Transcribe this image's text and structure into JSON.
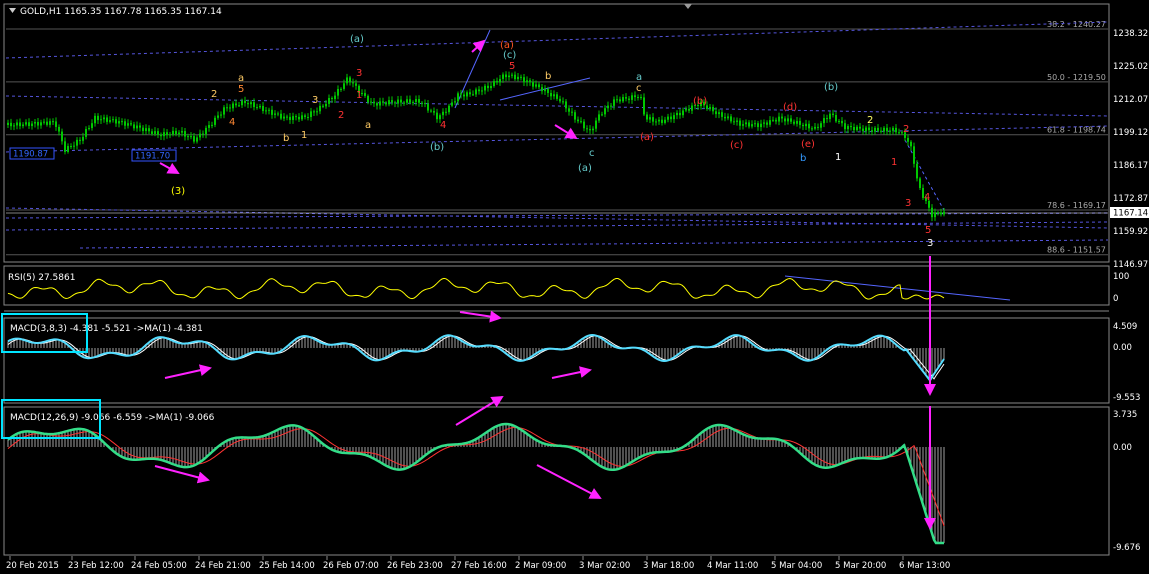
{
  "symbol_title": "GOLD,H1  1165.35 1167.78 1165.35 1167.14",
  "rsi_title": "RSI(5) 27.5861",
  "macd_fast_title": "MACD(3,8,3) -4.381 -5.521  ->MA(1) -4.381",
  "macd_slow_title": "MACD(12,26,9) -9.066 -6.559  ->MA(1) -9.066",
  "price_axis": [
    "1238.32",
    "1225.02",
    "1212.07",
    "1199.12",
    "1186.17",
    "1172.87",
    "1159.92",
    "1146.97"
  ],
  "current_price": "1167.14",
  "fib_levels": [
    {
      "label": "38.2 - 1240.27",
      "price": 1240.27
    },
    {
      "label": "50.0 - 1219.50",
      "price": 1219.5
    },
    {
      "label": "61.8 - 1198.74",
      "price": 1198.74
    },
    {
      "label": "78.6 - 1169.17",
      "price": 1169.17
    },
    {
      "label": "88.6 - 1151.57",
      "price": 1151.57
    }
  ],
  "price_boxes": [
    "1190.87",
    "1191.70"
  ],
  "rsi_axis": [
    "100",
    "0"
  ],
  "macd_fast_axis": [
    "4.509",
    "0.00",
    "-9.553"
  ],
  "macd_slow_axis": [
    "3.735",
    "0.00",
    "-9.676"
  ],
  "time_axis": [
    "20 Feb 2015",
    "23 Feb 12:00",
    "24 Feb 05:00",
    "24 Feb 21:00",
    "25 Feb 14:00",
    "26 Feb 07:00",
    "26 Feb 23:00",
    "27 Feb 16:00",
    "2 Mar 09:00",
    "3 Mar 02:00",
    "3 Mar 18:00",
    "4 Mar 11:00",
    "5 Mar 04:00",
    "5 Mar 20:00",
    "6 Mar 13:00"
  ],
  "wave_labels": [
    {
      "t": "(3)",
      "c": "#ffff00"
    },
    {
      "t": "(a)",
      "c": "#66cccc"
    },
    {
      "t": "(b)",
      "c": "#66cccc"
    },
    {
      "t": "(a)",
      "c": "#ff5522"
    },
    {
      "t": "(c)",
      "c": "#66cccc"
    },
    {
      "t": "(a)",
      "c": "#66cccc"
    },
    {
      "t": "(b)",
      "c": "#66cccc"
    },
    {
      "t": "a",
      "c": "#ffcc66"
    },
    {
      "t": "b",
      "c": "#ffcc66"
    },
    {
      "t": "c",
      "c": "#66cccc"
    },
    {
      "t": "1",
      "c": "#ffcc66"
    },
    {
      "t": "2",
      "c": "#ffcc66"
    },
    {
      "t": "3",
      "c": "#ffcc66"
    },
    {
      "t": "4",
      "c": "#ff8833"
    },
    {
      "t": "5",
      "c": "#ff8833"
    },
    {
      "t": "1",
      "c": "#ff3333"
    },
    {
      "t": "2",
      "c": "#ff3333"
    },
    {
      "t": "3",
      "c": "#ff3333"
    },
    {
      "t": "4",
      "c": "#ff3333"
    },
    {
      "t": "5",
      "c": "#ff3333"
    },
    {
      "t": "a",
      "c": "#ffcc66"
    },
    {
      "t": "b",
      "c": "#ffcc66"
    },
    {
      "t": "c",
      "c": "#ffcc66"
    },
    {
      "t": "a",
      "c": "#66cccc"
    },
    {
      "t": "(a)",
      "c": "#ff3333"
    },
    {
      "t": "(b)",
      "c": "#ff3333"
    },
    {
      "t": "(c)",
      "c": "#ff3333"
    },
    {
      "t": "(d)",
      "c": "#ff3333"
    },
    {
      "t": "(e)",
      "c": "#ff3333"
    },
    {
      "t": "b",
      "c": "#3399ff"
    },
    {
      "t": "1",
      "c": "#ffffff"
    },
    {
      "t": "2",
      "c": "#ffff66"
    },
    {
      "t": "1",
      "c": "#ff3333"
    },
    {
      "t": "2",
      "c": "#ff3333"
    },
    {
      "t": "3",
      "c": "#ff3333"
    },
    {
      "t": "4",
      "c": "#ff3333"
    },
    {
      "t": "5",
      "c": "#ff3333"
    },
    {
      "t": "3",
      "c": "#ffffff"
    }
  ],
  "colors": {
    "background": "#000000",
    "grid": "#333333",
    "candle": "#00c800",
    "rsi": "#ffff00",
    "macd_line": "#55ddff",
    "macd_signal": "#ffffff",
    "macd_slow_line": "#33dd88",
    "macd_slow_signal": "#ff3333",
    "histogram": "#a0a0a0",
    "arrow": "#ff22ff",
    "fib": "#5555dd",
    "highlight": "#00e5ff"
  }
}
